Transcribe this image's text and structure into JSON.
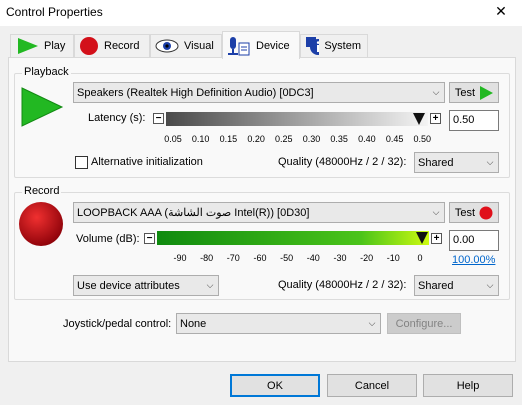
{
  "window": {
    "title": "Control Properties",
    "close_glyph": "✕"
  },
  "tabs": [
    {
      "label": "Play",
      "icon": "play-icon"
    },
    {
      "label": "Record",
      "icon": "record-icon"
    },
    {
      "label": "Visual",
      "icon": "eye-icon"
    },
    {
      "label": "Device",
      "icon": "device-icon",
      "active": true
    },
    {
      "label": "System",
      "icon": "info-icon"
    }
  ],
  "playback": {
    "group_label": "Playback",
    "device": "Speakers (Realtek High Definition Audio) [0DC3]",
    "test_label": "Test",
    "latency_label": "Latency (s):",
    "latency_ticks": [
      "0.05",
      "0.10",
      "0.15",
      "0.20",
      "0.25",
      "0.30",
      "0.35",
      "0.40",
      "0.45",
      "0.50"
    ],
    "latency_value": "0.50",
    "latency_fraction": 1.0,
    "alt_init_label": "Alternative initialization",
    "alt_init_checked": false,
    "quality_label": "Quality (48000Hz / 2 / 32):",
    "quality_value": "Shared"
  },
  "record": {
    "group_label": "Record",
    "device": "LOOPBACK AAA (صوت الشاشة Intel(R)) [0D30]",
    "test_label": "Test",
    "volume_label": "Volume (dB):",
    "volume_ticks": [
      "-90",
      "-80",
      "-70",
      "-60",
      "-50",
      "-40",
      "-30",
      "-20",
      "-10",
      "0"
    ],
    "volume_value": "0.00",
    "volume_percent": "100.00%",
    "volume_fraction": 1.0,
    "attributes_value": "Use device attributes",
    "quality_label": "Quality (48000Hz / 2 / 32):",
    "quality_value": "Shared"
  },
  "joystick": {
    "label": "Joystick/pedal control:",
    "value": "None",
    "configure_label": "Configure..."
  },
  "buttons": {
    "ok": "OK",
    "cancel": "Cancel",
    "help": "Help"
  },
  "colors": {
    "play_green": "#22b822",
    "record_red": "#c8101a",
    "accent": "#0078d7"
  }
}
